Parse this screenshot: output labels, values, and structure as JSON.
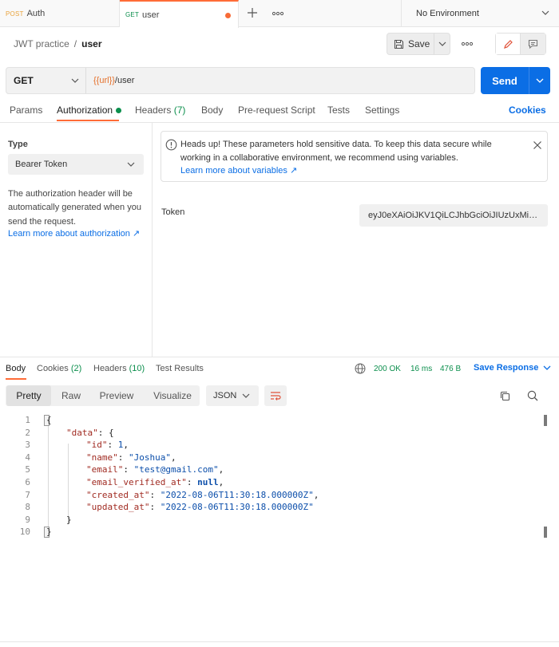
{
  "tabs": [
    {
      "method": "POST",
      "name": "Auth",
      "method_color": "#e8a33b"
    },
    {
      "method": "GET",
      "name": "user",
      "method_color": "#0c8f4d"
    }
  ],
  "environment": "No Environment",
  "breadcrumb": {
    "collection": "JWT practice",
    "separator": "/",
    "request": "user"
  },
  "header_actions": {
    "save_label": "Save"
  },
  "request": {
    "method": "GET",
    "url_var": "{{url}}",
    "url_path": "/user",
    "send_label": "Send"
  },
  "request_tabs": [
    {
      "label": "Params"
    },
    {
      "label": "Authorization"
    },
    {
      "label": "Headers",
      "count": "(7)"
    },
    {
      "label": "Body"
    },
    {
      "label": "Pre-request Script"
    },
    {
      "label": "Tests"
    },
    {
      "label": "Settings"
    }
  ],
  "cookies_link": "Cookies",
  "auth": {
    "type_label": "Type",
    "type_value": "Bearer Token",
    "description": "The authorization header will be automatically generated when you send the request.",
    "learn_more": "Learn more about authorization ↗",
    "notice": "Heads up! These parameters hold sensitive data. To keep this data secure while working in a collaborative environment, we recommend using variables.",
    "notice_link": "Learn more about variables ↗",
    "token_label": "Token",
    "token_value": "eyJ0eXAiOiJKV1QiLCJhbGciOiJIUzUxMiJ9..."
  },
  "response": {
    "tabs": [
      {
        "label": "Body"
      },
      {
        "label": "Cookies",
        "count": "(2)"
      },
      {
        "label": "Headers",
        "count": "(10)"
      },
      {
        "label": "Test Results"
      }
    ],
    "status": "200 OK",
    "time": "16 ms",
    "size": "476 B",
    "save_response": "Save Response",
    "view_modes": [
      "Pretty",
      "Raw",
      "Preview",
      "Visualize"
    ],
    "format": "JSON"
  },
  "code_lines": [
    {
      "n": "1",
      "text": "{"
    },
    {
      "n": "2",
      "key": "\"data\"",
      "rest": ": {"
    },
    {
      "n": "3",
      "key": "\"id\"",
      "rest": ": ",
      "val": "1",
      "vt": "num",
      "tail": ","
    },
    {
      "n": "4",
      "key": "\"name\"",
      "rest": ": ",
      "val": "\"Joshua\"",
      "vt": "str",
      "tail": ","
    },
    {
      "n": "5",
      "key": "\"email\"",
      "rest": ": ",
      "val": "\"test@gmail.com\"",
      "vt": "str",
      "tail": ","
    },
    {
      "n": "6",
      "key": "\"email_verified_at\"",
      "rest": ": ",
      "val": "null",
      "vt": "null",
      "tail": ","
    },
    {
      "n": "7",
      "key": "\"created_at\"",
      "rest": ": ",
      "val": "\"2022-08-06T11:30:18.000000Z\"",
      "vt": "str",
      "tail": ","
    },
    {
      "n": "8",
      "key": "\"updated_at\"",
      "rest": ": ",
      "val": "\"2022-08-06T11:30:18.000000Z\"",
      "vt": "str",
      "tail": ""
    },
    {
      "n": "9",
      "text": "}"
    },
    {
      "n": "10",
      "text": "}"
    }
  ]
}
